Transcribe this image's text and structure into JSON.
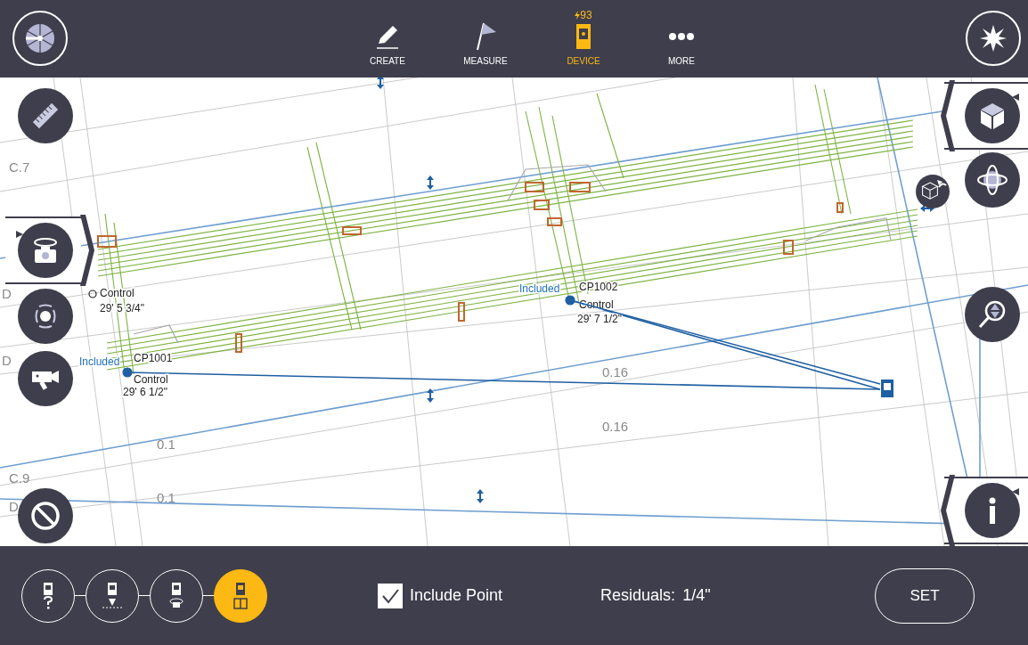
{
  "top_bar": {
    "tabs": [
      {
        "kind": "create",
        "label": "CREATE",
        "selected": false
      },
      {
        "kind": "measure",
        "label": "MEASURE",
        "selected": false
      },
      {
        "kind": "device",
        "label": "DEVICE",
        "selected": true,
        "battery": "93"
      },
      {
        "kind": "more",
        "label": "MORE",
        "selected": false
      }
    ]
  },
  "canvas": {
    "grid_labels": [
      "C.7",
      "D",
      "D",
      "C.9",
      "D",
      "0.16",
      "0.16",
      "0.1",
      "0.1"
    ],
    "points": [
      {
        "type": "Control",
        "distance": "29' 5 3/4\""
      },
      {
        "name": "CP1002",
        "type": "Control",
        "distance": "29' 7 1/2\"",
        "status": "Included"
      },
      {
        "name": "CP1001",
        "type": "Control",
        "distance": "29' 6 1/2\"",
        "status": "Included"
      }
    ]
  },
  "bottom_bar": {
    "steps": [
      {
        "kind": "unknown",
        "selected": false
      },
      {
        "kind": "setup",
        "selected": false
      },
      {
        "kind": "target",
        "selected": false
      },
      {
        "kind": "model",
        "selected": true
      }
    ],
    "include_point": {
      "label": "Include Point",
      "checked": true
    },
    "residuals": {
      "label": "Residuals:",
      "value": "1/4\""
    },
    "set_button": "SET"
  }
}
